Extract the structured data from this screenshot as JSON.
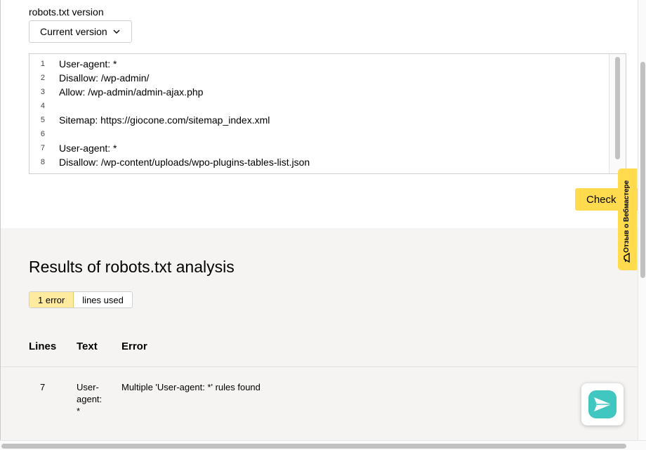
{
  "version": {
    "label": "robots.txt version",
    "selected": "Current version"
  },
  "editor": {
    "lines": [
      {
        "num": "1",
        "text": "User-agent: *"
      },
      {
        "num": "2",
        "text": "Disallow: /wp-admin/"
      },
      {
        "num": "3",
        "text": "Allow: /wp-admin/admin-ajax.php"
      },
      {
        "num": "4",
        "text": ""
      },
      {
        "num": "5",
        "text": "Sitemap: https://giocone.com/sitemap_index.xml"
      },
      {
        "num": "6",
        "text": ""
      },
      {
        "num": "7",
        "text": "User-agent: *"
      },
      {
        "num": "8",
        "text": "Disallow: /wp-content/uploads/wpo-plugins-tables-list.json"
      }
    ]
  },
  "check_label": "Check",
  "feedback_label": "Отзыв о Вебмастере",
  "results": {
    "title": "Results of robots.txt analysis",
    "filters": [
      {
        "label": "1 error",
        "active": true
      },
      {
        "label": "lines used",
        "active": false
      }
    ],
    "columns": [
      "Lines",
      "Text",
      "Error"
    ],
    "rows": [
      {
        "line": "7",
        "text_lines": [
          "User-",
          "agent:",
          "*"
        ],
        "error": "Multiple 'User-agent: *' rules found"
      }
    ]
  },
  "colors": {
    "accent": "#ffdb4d",
    "filter_active": "#ffeba0",
    "results_bg": "#f5f4f2",
    "chat_brand": "#3fc7c0"
  },
  "icons": {
    "chevron": "chevron-down-icon",
    "feedback": "megaphone-icon",
    "chat": "paper-plane-icon"
  }
}
